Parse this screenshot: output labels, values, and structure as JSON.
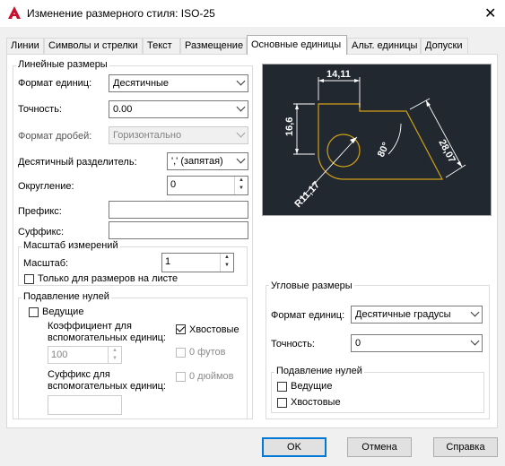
{
  "window": {
    "title": "Изменение размерного стиля: ISO-25"
  },
  "tabs": [
    {
      "label": "Линии"
    },
    {
      "label": "Символы и стрелки"
    },
    {
      "label": "Текст"
    },
    {
      "label": "Размещение"
    },
    {
      "label": "Основные единицы"
    },
    {
      "label": "Альт. единицы"
    },
    {
      "label": "Допуски"
    }
  ],
  "linear": {
    "group_title": "Линейные размеры",
    "unit_format_label": "Формат единиц:",
    "unit_format_value": "Десятичные",
    "precision_label": "Точность:",
    "precision_value": "0.00",
    "fraction_format_label": "Формат дробей:",
    "fraction_format_value": "Горизонтально",
    "decimal_sep_label": "Десятичный  разделитель:",
    "decimal_sep_value": "',' (запятая)",
    "round_label": "Округление:",
    "round_value": "0",
    "prefix_label": "Префикс:",
    "prefix_value": "",
    "suffix_label": "Суффикс:",
    "suffix_value": ""
  },
  "scale": {
    "group_title": "Масштаб измерений",
    "scale_label": "Масштаб:",
    "scale_value": "1",
    "layout_only_label": "Только для размеров на листе"
  },
  "zero_linear": {
    "group_title": "Подавление нулей",
    "leading_label": "Ведущие",
    "leading_checked": false,
    "sub_factor_label_1": "Коэффициент для",
    "sub_factor_label_2": "вспомогательных единиц:",
    "sub_factor_value": "100",
    "sub_suffix_label_1": "Суффикс для",
    "sub_suffix_label_2": "вспомогательных единиц:",
    "sub_suffix_value": "",
    "trailing_label": "Хвостовые",
    "trailing_checked": true,
    "feet_label": "0 футов",
    "inches_label": "0 дюймов"
  },
  "angular": {
    "group_title": "Угловые размеры",
    "unit_format_label": "Формат единиц:",
    "unit_format_value": "Десятичные градусы",
    "precision_label": "Точность:",
    "precision_value": "0",
    "zero_group_title": "Подавление нулей",
    "leading_label": "Ведущие",
    "trailing_label": "Хвостовые"
  },
  "preview": {
    "dim_top": "14,11",
    "dim_left": "16,6",
    "dim_right": "28,07",
    "dim_angle": "80°",
    "dim_radius": "R11,17",
    "colors": {
      "background": "#212830",
      "geometry": "#d4a017",
      "dims": "#ffffff"
    }
  },
  "buttons": {
    "ok": "OK",
    "cancel": "Отмена",
    "help": "Справка"
  },
  "colors": {
    "accent": "#0078d7",
    "autocad_red": "#c8102e"
  }
}
